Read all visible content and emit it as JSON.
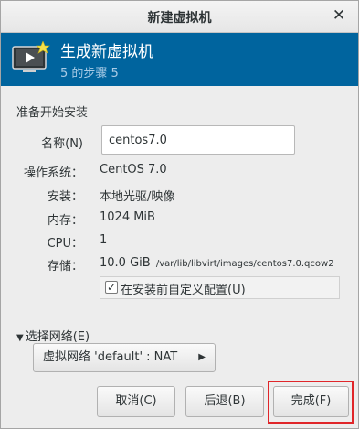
{
  "window": {
    "title": "新建虚拟机",
    "close_glyph": "✕"
  },
  "header": {
    "title": "生成新虚拟机",
    "step": "5 的步骤 5"
  },
  "section_title": "准备开始安装",
  "name_field": {
    "label": "名称(N)",
    "value": "centos7.0"
  },
  "details": [
    {
      "label": "操作系统：",
      "value": "CentOS 7.0"
    },
    {
      "label": "安装：",
      "value": "本地光驱/映像"
    },
    {
      "label": "内存：",
      "value": "1024 MiB"
    },
    {
      "label": "CPU：",
      "value": "1"
    },
    {
      "label": "存储：",
      "value": "10.0 GiB",
      "detail": "/var/lib/libvirt/images/centos7.0.qcow2"
    }
  ],
  "customize_checkbox": {
    "label": "在安装前自定义配置(U)",
    "checked": true
  },
  "network": {
    "expander_label": "选择网络(E)",
    "selected": "虚拟网络 'default' : NAT"
  },
  "buttons": {
    "cancel": "取消(C)",
    "back": "后退(B)",
    "finish": "完成(F)"
  },
  "colors": {
    "header_bg": "#00649e",
    "highlight": "#e0262a"
  }
}
